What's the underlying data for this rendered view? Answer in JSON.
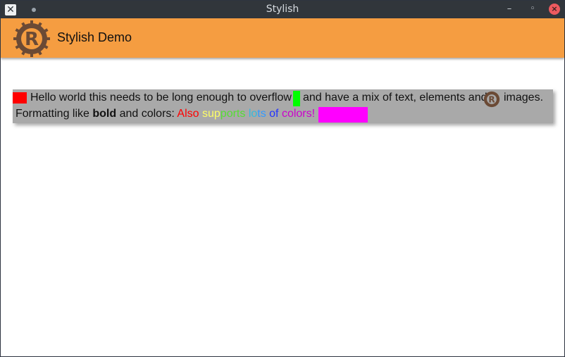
{
  "titlebar": {
    "title": "Stylish",
    "close_left_icon": "x-icon",
    "minimize_glyph": "–",
    "restore_glyph": "▫",
    "close_glyph": "×"
  },
  "header": {
    "title": "Stylish Demo",
    "logo_icon": "rust-gear-logo",
    "color": "#f59d41"
  },
  "card": {
    "line1": {
      "text_a": "Hello world this needs to be long enough to overflow",
      "text_b": "and have a mix of text, elements and",
      "text_c": "images."
    },
    "line2": {
      "prefix": "Formatting like ",
      "bold": "bold",
      "middle": " and colors: ",
      "rainbow": [
        {
          "text": "Also ",
          "color": "#ff0000"
        },
        {
          "text": "sup",
          "color": "#ffff66"
        },
        {
          "text": "ports ",
          "color": "#55dd33"
        },
        {
          "text": "lo",
          "color": "#33bbdd"
        },
        {
          "text": "ts ",
          "color": "#3399ff"
        },
        {
          "text": "of ",
          "color": "#2233ff"
        },
        {
          "text": "colors!",
          "color": "#cc00cc"
        }
      ]
    },
    "swatches": {
      "red": "#ff0000",
      "green": "#00ff00",
      "magenta": "#ff00ff"
    }
  }
}
